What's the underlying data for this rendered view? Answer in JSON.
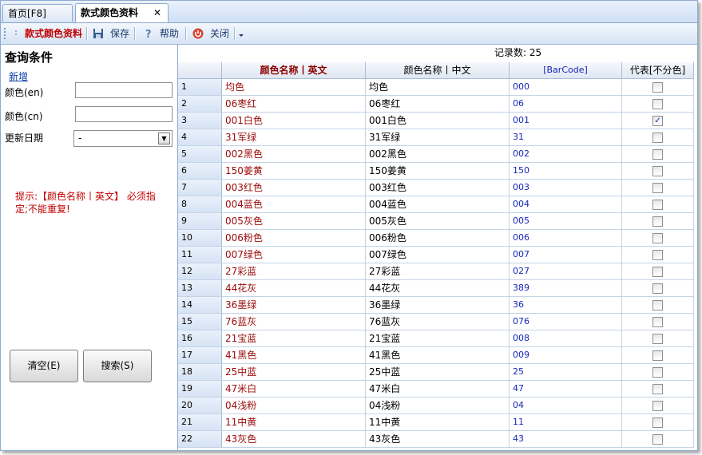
{
  "tabs": [
    {
      "label": "首页[F8]"
    },
    {
      "label": "款式颜色资料",
      "close": "✕"
    }
  ],
  "toolbar": {
    "title": "款式颜色资料",
    "save": "保存",
    "help": "帮助",
    "close": "关闭"
  },
  "query": {
    "title": "查询条件",
    "new_link": "新增",
    "color_en_label": "颜色(en)",
    "color_cn_label": "颜色(cn)",
    "date_label": "更新日期",
    "date_value": "-",
    "tip": "提示:【颜色名称丨英文】 必须指定;不能重复!",
    "clear_button": "清空(E)",
    "search_button": "搜索(S)"
  },
  "grid": {
    "record_count": "记录数: 25",
    "columns": [
      "",
      "颜色名称丨英文",
      "颜色名称丨中文",
      "[BarCode]",
      "代表[不分色]"
    ],
    "rows": [
      {
        "n": "1",
        "en": "均色",
        "cn": "均色",
        "code": "000",
        "checked": false
      },
      {
        "n": "2",
        "en": "06枣红",
        "cn": "06枣红",
        "code": "06",
        "checked": false
      },
      {
        "n": "3",
        "en": "001白色",
        "cn": "001白色",
        "code": "001",
        "checked": true
      },
      {
        "n": "4",
        "en": "31军绿",
        "cn": "31军绿",
        "code": "31",
        "checked": false
      },
      {
        "n": "5",
        "en": "002黑色",
        "cn": "002黑色",
        "code": "002",
        "checked": false
      },
      {
        "n": "6",
        "en": "150姜黄",
        "cn": "150姜黄",
        "code": "150",
        "checked": false
      },
      {
        "n": "7",
        "en": "003红色",
        "cn": "003红色",
        "code": "003",
        "checked": false
      },
      {
        "n": "8",
        "en": "004蓝色",
        "cn": "004蓝色",
        "code": "004",
        "checked": false
      },
      {
        "n": "9",
        "en": "005灰色",
        "cn": "005灰色",
        "code": "005",
        "checked": false
      },
      {
        "n": "10",
        "en": "006粉色",
        "cn": "006粉色",
        "code": "006",
        "checked": false
      },
      {
        "n": "11",
        "en": "007绿色",
        "cn": "007绿色",
        "code": "007",
        "checked": false
      },
      {
        "n": "12",
        "en": "27彩蓝",
        "cn": "27彩蓝",
        "code": "027",
        "checked": false
      },
      {
        "n": "13",
        "en": "44花灰",
        "cn": "44花灰",
        "code": "389",
        "checked": false
      },
      {
        "n": "14",
        "en": "36墨绿",
        "cn": "36墨绿",
        "code": "36",
        "checked": false
      },
      {
        "n": "15",
        "en": "76蓝灰",
        "cn": "76蓝灰",
        "code": "076",
        "checked": false
      },
      {
        "n": "16",
        "en": "21宝蓝",
        "cn": "21宝蓝",
        "code": "008",
        "checked": false
      },
      {
        "n": "17",
        "en": "41黑色",
        "cn": "41黑色",
        "code": "009",
        "checked": false
      },
      {
        "n": "18",
        "en": "25中蓝",
        "cn": "25中蓝",
        "code": "25",
        "checked": false
      },
      {
        "n": "19",
        "en": "47米白",
        "cn": "47米白",
        "code": "47",
        "checked": false
      },
      {
        "n": "20",
        "en": "04浅粉",
        "cn": "04浅粉",
        "code": "04",
        "checked": false
      },
      {
        "n": "21",
        "en": "11中黄",
        "cn": "11中黄",
        "code": "11",
        "checked": false
      },
      {
        "n": "22",
        "en": "43灰色",
        "cn": "43灰色",
        "code": "43",
        "checked": false
      }
    ]
  }
}
